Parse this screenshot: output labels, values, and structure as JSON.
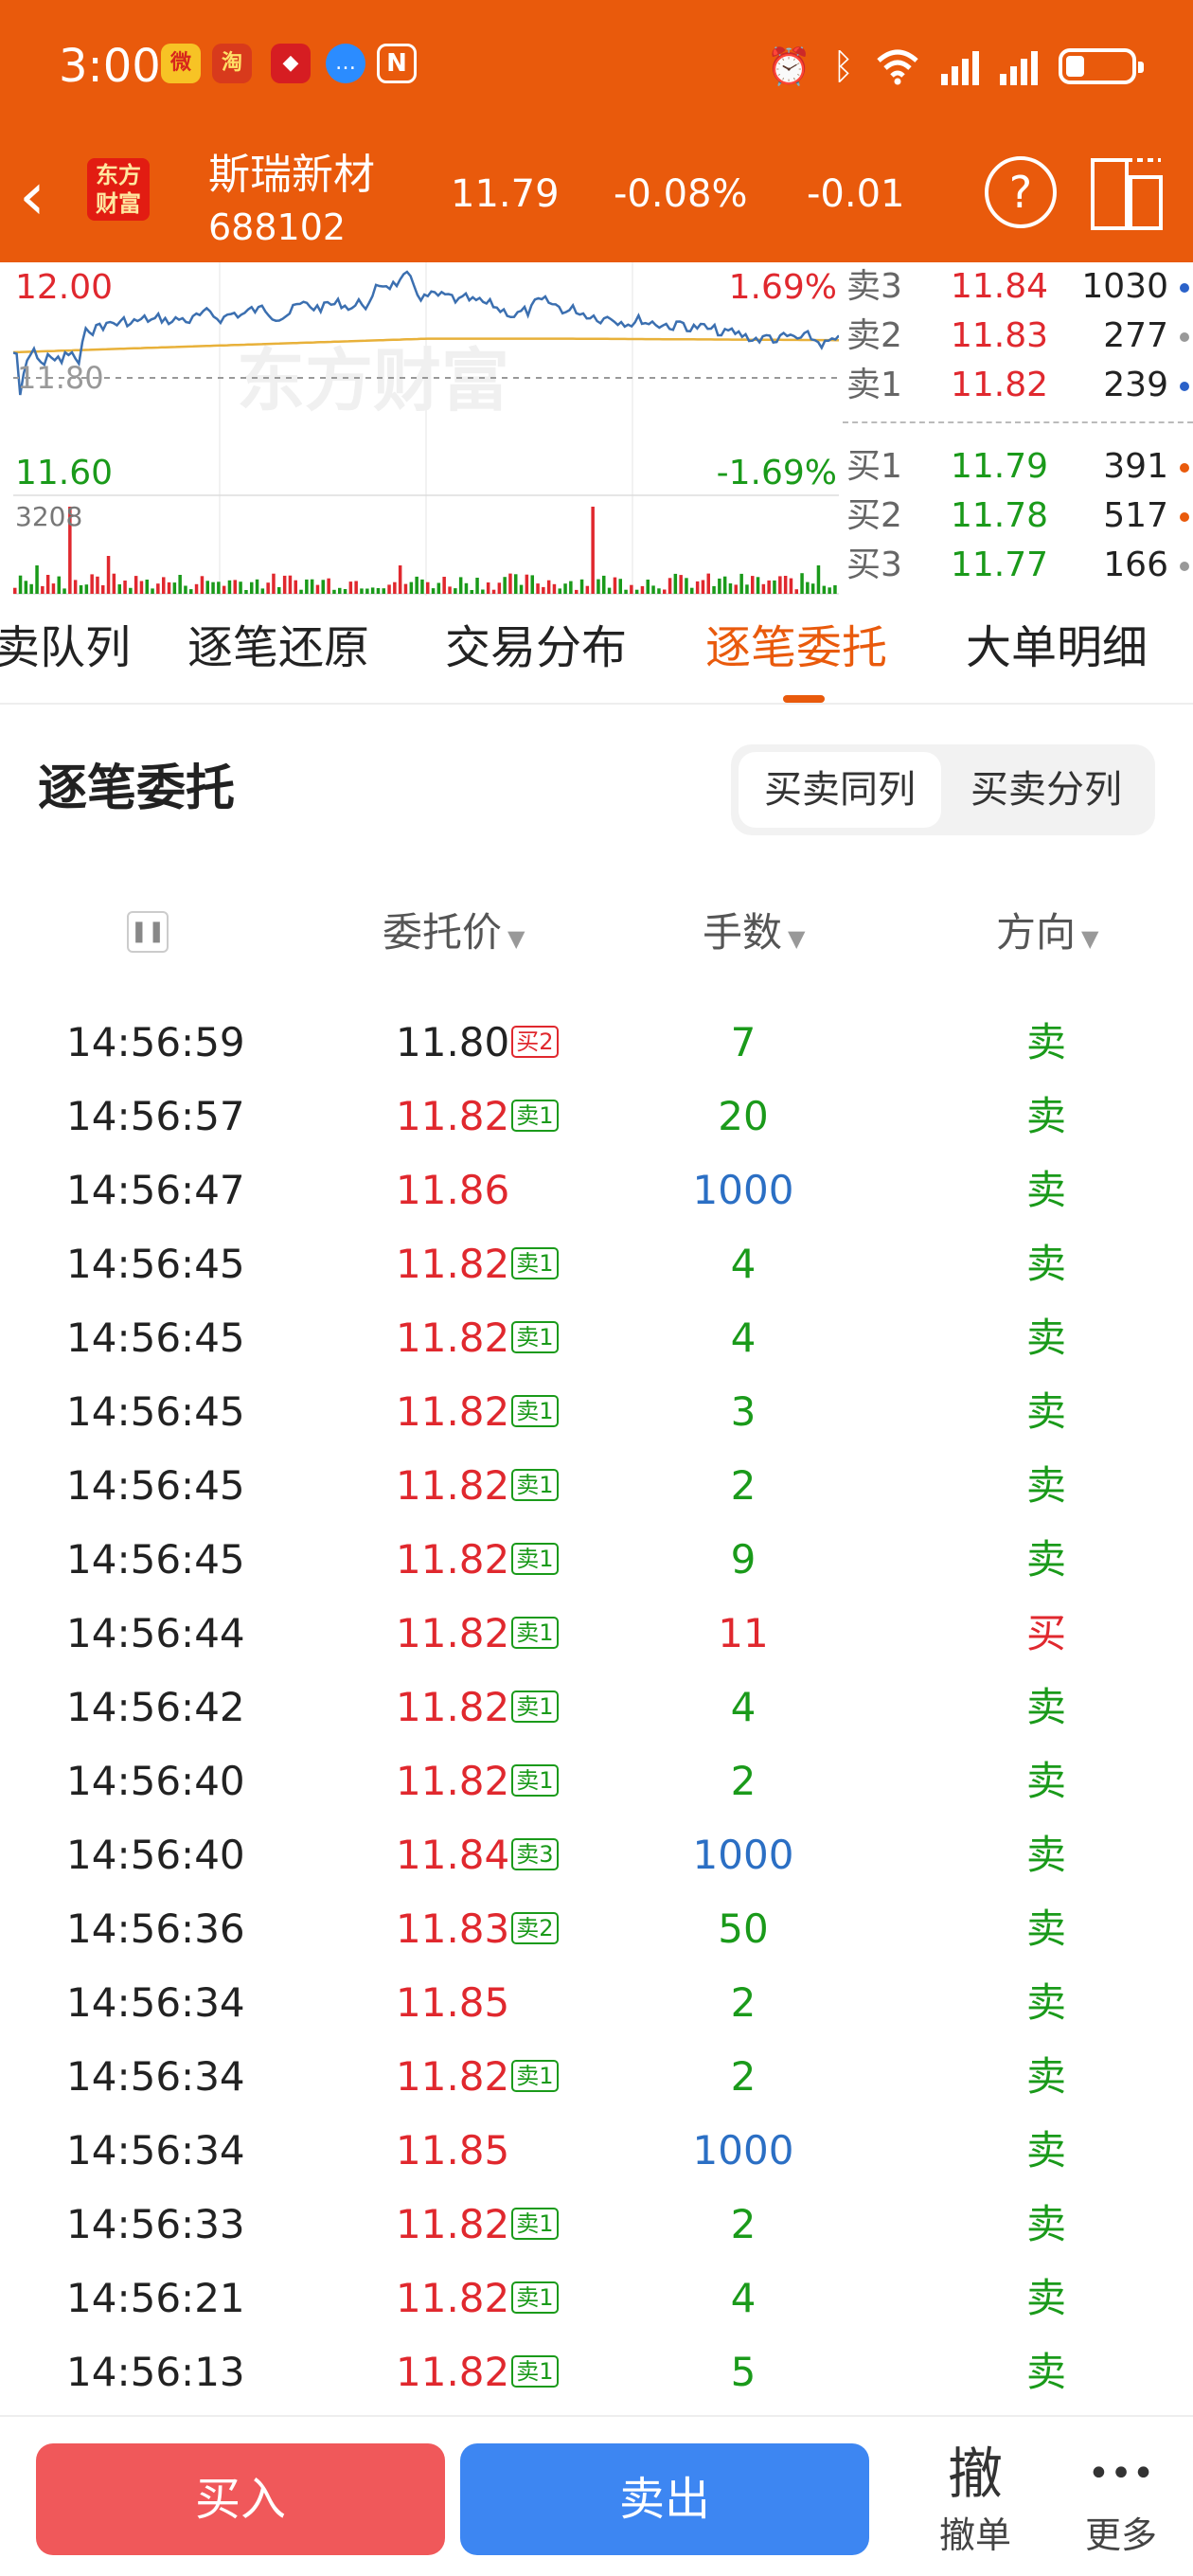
{
  "status_bar": {
    "time": "3:00",
    "app_icons": [
      "weibo-icon",
      "app-icon-2",
      "broker-app-icon",
      "message-icon",
      "nfc-icon"
    ],
    "right_icons": [
      "alarm-icon",
      "bluetooth-icon",
      "wifi-icon",
      "signal-icon",
      "signal-icon-2",
      "battery-icon"
    ],
    "battery_level": 0.25
  },
  "header": {
    "logo_text": "东方财富",
    "stock_name": "斯瑞新材",
    "stock_code": "688102",
    "price": "11.79",
    "change_pct": "-0.08%",
    "change_abs": "-0.01",
    "help_label": "?",
    "colors": {
      "bar": "#e95a0c"
    }
  },
  "chart": {
    "price_high_label": "12.00",
    "price_high_pct": "1.69%",
    "price_low_label": "11.60",
    "price_low_pct": "-1.69%",
    "prev_close_label": "11.80",
    "volume_max_label": "3208",
    "watermark": "东方财富",
    "colors": {
      "up": "#e0282e",
      "down": "#1a9a1a",
      "price_line": "#3b6fb0",
      "avg_line": "#e8b13a"
    }
  },
  "order_book": {
    "asks": [
      {
        "label": "卖3",
        "price": "11.84",
        "volume": "1030",
        "dot": "#2b62c9"
      },
      {
        "label": "卖2",
        "price": "11.83",
        "volume": "277",
        "dot": "#999999"
      },
      {
        "label": "卖1",
        "price": "11.82",
        "volume": "239",
        "dot": "#2b62c9"
      }
    ],
    "bids": [
      {
        "label": "买1",
        "price": "11.79",
        "volume": "391",
        "dot": "#e95a0c"
      },
      {
        "label": "买2",
        "price": "11.78",
        "volume": "517",
        "dot": "#e95a0c"
      },
      {
        "label": "买3",
        "price": "11.77",
        "volume": "166",
        "dot": "#999999"
      }
    ]
  },
  "tabs": [
    {
      "label": "买卖队列"
    },
    {
      "label": "逐笔还原"
    },
    {
      "label": "交易分布"
    },
    {
      "label": "逐笔委托",
      "active": true
    },
    {
      "label": "大单明细"
    }
  ],
  "section": {
    "title": "逐笔委托",
    "toggle_on": "买卖同列",
    "toggle_off": "买卖分列"
  },
  "columns": {
    "price": "委托价",
    "volume": "手数",
    "direction": "方向"
  },
  "entrusts": [
    {
      "time": "14:56:59",
      "price": "11.80",
      "tag": "买2",
      "volume": "7",
      "dir": "卖",
      "price_color": "#222222",
      "tag_color": "#e0282e",
      "vol_color": "#1a9a1a",
      "dir_color": "#1a9a1a"
    },
    {
      "time": "14:56:57",
      "price": "11.82",
      "tag": "卖1",
      "volume": "20",
      "dir": "卖",
      "price_color": "#e0282e",
      "tag_color": "#1a9a1a",
      "vol_color": "#1a9a1a",
      "dir_color": "#1a9a1a"
    },
    {
      "time": "14:56:47",
      "price": "11.86",
      "tag": "",
      "volume": "1000",
      "dir": "卖",
      "price_color": "#e0282e",
      "tag_color": "#1a9a1a",
      "vol_color": "#2b6fc4",
      "dir_color": "#1a9a1a"
    },
    {
      "time": "14:56:45",
      "price": "11.82",
      "tag": "卖1",
      "volume": "4",
      "dir": "卖",
      "price_color": "#e0282e",
      "tag_color": "#1a9a1a",
      "vol_color": "#1a9a1a",
      "dir_color": "#1a9a1a"
    },
    {
      "time": "14:56:45",
      "price": "11.82",
      "tag": "卖1",
      "volume": "4",
      "dir": "卖",
      "price_color": "#e0282e",
      "tag_color": "#1a9a1a",
      "vol_color": "#1a9a1a",
      "dir_color": "#1a9a1a"
    },
    {
      "time": "14:56:45",
      "price": "11.82",
      "tag": "卖1",
      "volume": "3",
      "dir": "卖",
      "price_color": "#e0282e",
      "tag_color": "#1a9a1a",
      "vol_color": "#1a9a1a",
      "dir_color": "#1a9a1a"
    },
    {
      "time": "14:56:45",
      "price": "11.82",
      "tag": "卖1",
      "volume": "2",
      "dir": "卖",
      "price_color": "#e0282e",
      "tag_color": "#1a9a1a",
      "vol_color": "#1a9a1a",
      "dir_color": "#1a9a1a"
    },
    {
      "time": "14:56:45",
      "price": "11.82",
      "tag": "卖1",
      "volume": "9",
      "dir": "卖",
      "price_color": "#e0282e",
      "tag_color": "#1a9a1a",
      "vol_color": "#1a9a1a",
      "dir_color": "#1a9a1a"
    },
    {
      "time": "14:56:44",
      "price": "11.82",
      "tag": "卖1",
      "volume": "11",
      "dir": "买",
      "price_color": "#e0282e",
      "tag_color": "#1a9a1a",
      "vol_color": "#e0282e",
      "dir_color": "#e0282e"
    },
    {
      "time": "14:56:42",
      "price": "11.82",
      "tag": "卖1",
      "volume": "4",
      "dir": "卖",
      "price_color": "#e0282e",
      "tag_color": "#1a9a1a",
      "vol_color": "#1a9a1a",
      "dir_color": "#1a9a1a"
    },
    {
      "time": "14:56:40",
      "price": "11.82",
      "tag": "卖1",
      "volume": "2",
      "dir": "卖",
      "price_color": "#e0282e",
      "tag_color": "#1a9a1a",
      "vol_color": "#1a9a1a",
      "dir_color": "#1a9a1a"
    },
    {
      "time": "14:56:40",
      "price": "11.84",
      "tag": "卖3",
      "volume": "1000",
      "dir": "卖",
      "price_color": "#e0282e",
      "tag_color": "#1a9a1a",
      "vol_color": "#2b6fc4",
      "dir_color": "#1a9a1a"
    },
    {
      "time": "14:56:36",
      "price": "11.83",
      "tag": "卖2",
      "volume": "50",
      "dir": "卖",
      "price_color": "#e0282e",
      "tag_color": "#1a9a1a",
      "vol_color": "#1a9a1a",
      "dir_color": "#1a9a1a"
    },
    {
      "time": "14:56:34",
      "price": "11.85",
      "tag": "",
      "volume": "2",
      "dir": "卖",
      "price_color": "#e0282e",
      "tag_color": "#1a9a1a",
      "vol_color": "#1a9a1a",
      "dir_color": "#1a9a1a"
    },
    {
      "time": "14:56:34",
      "price": "11.82",
      "tag": "卖1",
      "volume": "2",
      "dir": "卖",
      "price_color": "#e0282e",
      "tag_color": "#1a9a1a",
      "vol_color": "#1a9a1a",
      "dir_color": "#1a9a1a"
    },
    {
      "time": "14:56:34",
      "price": "11.85",
      "tag": "",
      "volume": "1000",
      "dir": "卖",
      "price_color": "#e0282e",
      "tag_color": "#1a9a1a",
      "vol_color": "#2b6fc4",
      "dir_color": "#1a9a1a"
    },
    {
      "time": "14:56:33",
      "price": "11.82",
      "tag": "卖1",
      "volume": "2",
      "dir": "卖",
      "price_color": "#e0282e",
      "tag_color": "#1a9a1a",
      "vol_color": "#1a9a1a",
      "dir_color": "#1a9a1a"
    },
    {
      "time": "14:56:21",
      "price": "11.82",
      "tag": "卖1",
      "volume": "4",
      "dir": "卖",
      "price_color": "#e0282e",
      "tag_color": "#1a9a1a",
      "vol_color": "#1a9a1a",
      "dir_color": "#1a9a1a"
    },
    {
      "time": "14:56:13",
      "price": "11.82",
      "tag": "卖1",
      "volume": "5",
      "dir": "卖",
      "price_color": "#e0282e",
      "tag_color": "#1a9a1a",
      "vol_color": "#1a9a1a",
      "dir_color": "#1a9a1a"
    }
  ],
  "bottom_bar": {
    "buy_label": "买入",
    "sell_label": "卖出",
    "cancel_icon": "撤",
    "cancel_label": "撤单",
    "more_icon": "•••",
    "more_label": "更多",
    "colors": {
      "buy": "#f0585a",
      "sell": "#3d86f2"
    }
  }
}
